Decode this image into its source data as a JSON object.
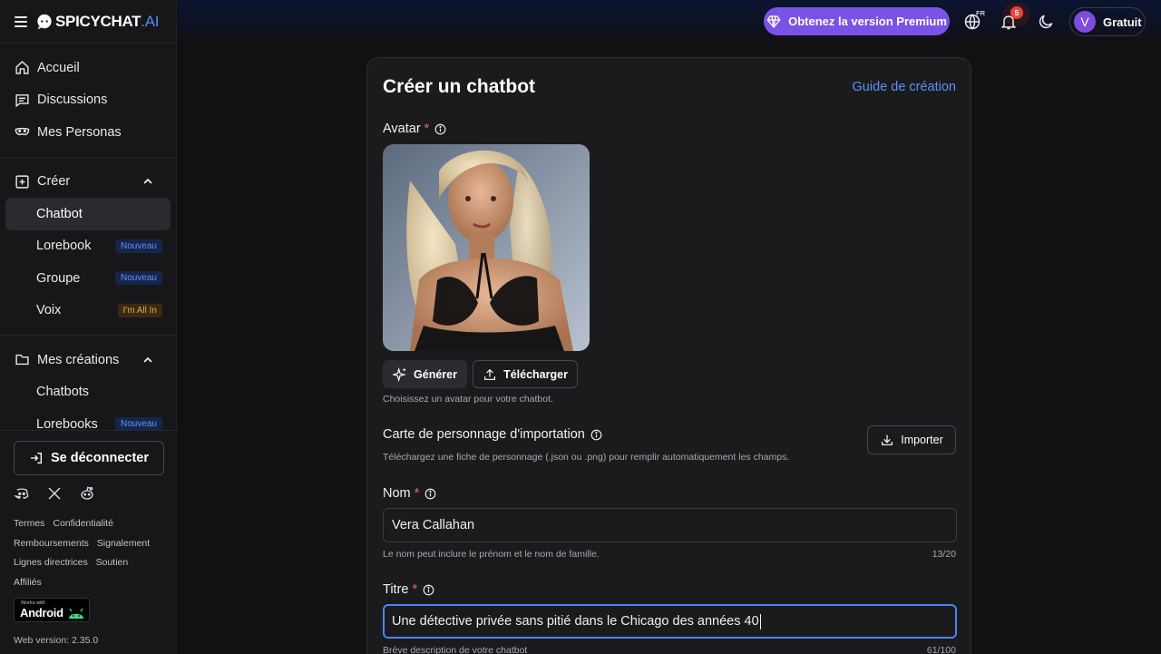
{
  "app": {
    "logo_main": "SPICYCHAT",
    "logo_suffix": ".AI"
  },
  "sidebar": {
    "main_items": [
      {
        "label": "Accueil",
        "icon": "home-icon"
      },
      {
        "label": "Discussions",
        "icon": "chat-icon"
      },
      {
        "label": "Mes Personas",
        "icon": "mask-icon"
      }
    ],
    "create": {
      "label": "Créer",
      "icon": "plus-square-icon",
      "items": [
        {
          "label": "Chatbot",
          "badge": ""
        },
        {
          "label": "Lorebook",
          "badge": "Nouveau"
        },
        {
          "label": "Groupe",
          "badge": "Nouveau"
        },
        {
          "label": "Voix",
          "badge": "I'm All In"
        }
      ]
    },
    "creations": {
      "label": "Mes créations",
      "icon": "folder-icon",
      "items": [
        {
          "label": "Chatbots",
          "badge": ""
        },
        {
          "label": "Lorebooks",
          "badge": "Nouveau"
        }
      ]
    },
    "logout_label": "Se déconnecter",
    "footer_links": [
      "Termes",
      "Confidentialité",
      "Remboursements",
      "Signalement",
      "Lignes directrices",
      "Soutien",
      "Affiliés"
    ],
    "android_small": "Works with",
    "android_label": "Android",
    "version": "Web version: 2.35.0"
  },
  "topbar": {
    "premium_label": "Obtenez la version Premium",
    "language": "FR",
    "notification_count": "5",
    "user_initial": "V",
    "plan_label": "Gratuit"
  },
  "form": {
    "title": "Créer un chatbot",
    "guide_link": "Guide de création",
    "avatar": {
      "label": "Avatar",
      "required": "*",
      "generate_label": "Générer",
      "upload_label": "Télécharger",
      "helper": "Choisissez un avatar pour votre chatbot."
    },
    "import": {
      "label": "Carte de personnage d'importation",
      "helper": "Téléchargez une fiche de personnage (.json ou .png) pour remplir automatiquement les champs.",
      "button_label": "Importer"
    },
    "name": {
      "label": "Nom",
      "required": "*",
      "value": "Vera Callahan",
      "helper": "Le nom peut inclure le prénom et le nom de famille.",
      "counter": "13/20"
    },
    "title_field": {
      "label": "Titre",
      "required": "*",
      "value": "Une détective privée sans pitié dans le Chicago des années 40",
      "helper": "Brève description de votre chatbot",
      "counter": "61/100"
    }
  },
  "colors": {
    "accent_blue": "#5b93f2",
    "premium_purple": "#7b52e6",
    "required_red": "#e8645c",
    "badge_new": "#5f93ff",
    "badge_allin": "#e7a84a"
  }
}
